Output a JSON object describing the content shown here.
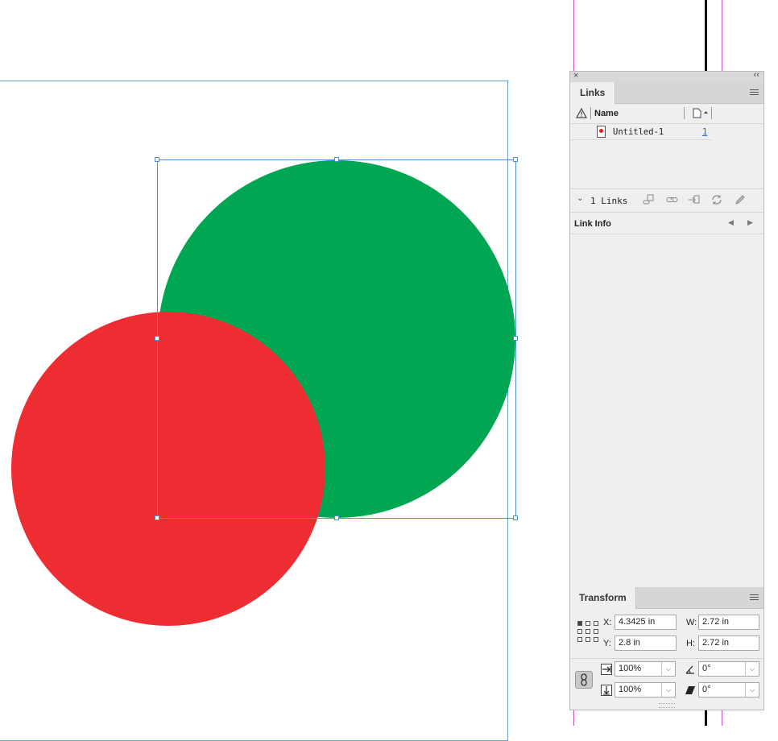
{
  "canvas": {
    "shapes": [
      {
        "name": "green-circle",
        "color": "#00a651"
      },
      {
        "name": "red-circle",
        "color": "#ee2d32"
      }
    ],
    "selection_color": "#4a90d9"
  },
  "links_panel": {
    "tab_label": "Links",
    "column_name": "Name",
    "items": [
      {
        "name": "Untitled-1",
        "page": "1"
      }
    ],
    "count_label": "1 Links",
    "link_info_title": "Link Info"
  },
  "transform_panel": {
    "tab_label": "Transform",
    "x_label": "X:",
    "x_value": "4.3425 in",
    "y_label": "Y:",
    "y_value": "2.8 in",
    "w_label": "W:",
    "w_value": "2.72 in",
    "h_label": "H:",
    "h_value": "2.72 in",
    "scale_x": "100%",
    "scale_y": "100%",
    "rotation": "0°",
    "shear": "0°"
  },
  "icons": {
    "close": "×",
    "collapse": "‹‹",
    "chevron": "⌄",
    "prev": "◀",
    "next": "▶",
    "dropdown": "⌵"
  }
}
